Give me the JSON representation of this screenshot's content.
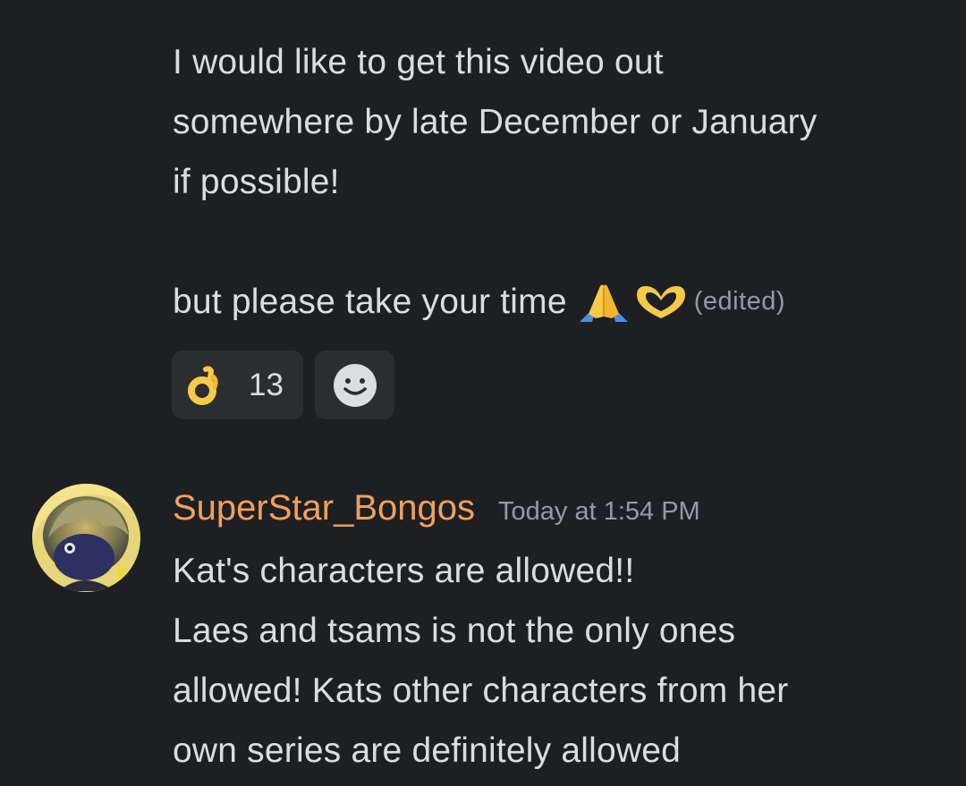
{
  "message_1": {
    "lines": [
      "I would like to get this video out",
      "somewhere by late December or January",
      "if possible!"
    ],
    "last_line": "but please take your time",
    "emoji": [
      "pray-emoji",
      "heart-hands-emoji"
    ],
    "edited_label": "(edited)",
    "reactions": [
      {
        "emoji": "ok-hand-emoji",
        "count": "13"
      },
      {
        "emoji": "add-reaction-icon"
      }
    ]
  },
  "message_2": {
    "author": "SuperStar_Bongos",
    "author_color": "#f0a060",
    "timestamp": "Today at 1:54 PM",
    "lines": [
      "Kat's characters are allowed!!",
      "Laes and tsams is not the only ones",
      "allowed! Kats other characters from her",
      "own series are definitely allowed"
    ]
  },
  "colors": {
    "background": "#1e1f22",
    "text": "#dbdee1",
    "muted": "#949ba4",
    "reaction_bg": "#2b2d31"
  }
}
